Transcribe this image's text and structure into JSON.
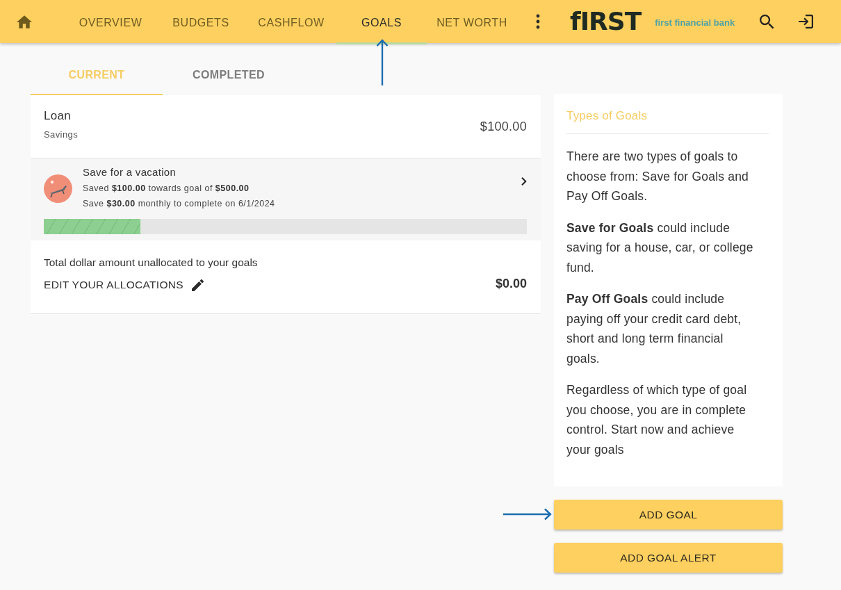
{
  "top_bar": {
    "nav_tabs": [
      {
        "label": "OVERVIEW",
        "selected": false
      },
      {
        "label": "BUDGETS",
        "selected": false
      },
      {
        "label": "CASHFLOW",
        "selected": false
      },
      {
        "label": "GOALS",
        "selected": true
      },
      {
        "label": "NET WORTH",
        "selected": false
      }
    ],
    "logo": {
      "wordmark": "fIRST",
      "tagline": "first financial bank"
    }
  },
  "goal_tabs": [
    {
      "label": "CURRENT",
      "selected": true
    },
    {
      "label": "COMPLETED",
      "selected": false
    }
  ],
  "account": {
    "name": "Loan",
    "type": "Savings",
    "balance": "$100.00"
  },
  "goals": [
    {
      "title": "Save for a vacation",
      "progress_text": "Saved **$100.00** towards goal of **$500.00**",
      "plan_text": "Save **$30.00** monthly to complete on 6/1/2024",
      "level": 0.2
    }
  ],
  "unallocated": {
    "label": "Total dollar amount unallocated to your goals",
    "edit_link": "EDIT YOUR ALLOCATIONS",
    "amount": "$0.00"
  },
  "info_panel": {
    "title": "Types of Goals",
    "paragraphs": [
      "There are two types of goals to choose from: Save for Goals and Pay Off Goals.",
      "**Save for Goals** could include saving for a house, car, or college fund.",
      "**Pay Off Goals** could include paying off your credit card debt, short and long term financial goals.",
      "Regardless of which type of goal you choose, you are in complete control. Start now and achieve your goals"
    ]
  },
  "buttons": [
    "ADD GOAL",
    "ADD GOAL ALERT"
  ]
}
